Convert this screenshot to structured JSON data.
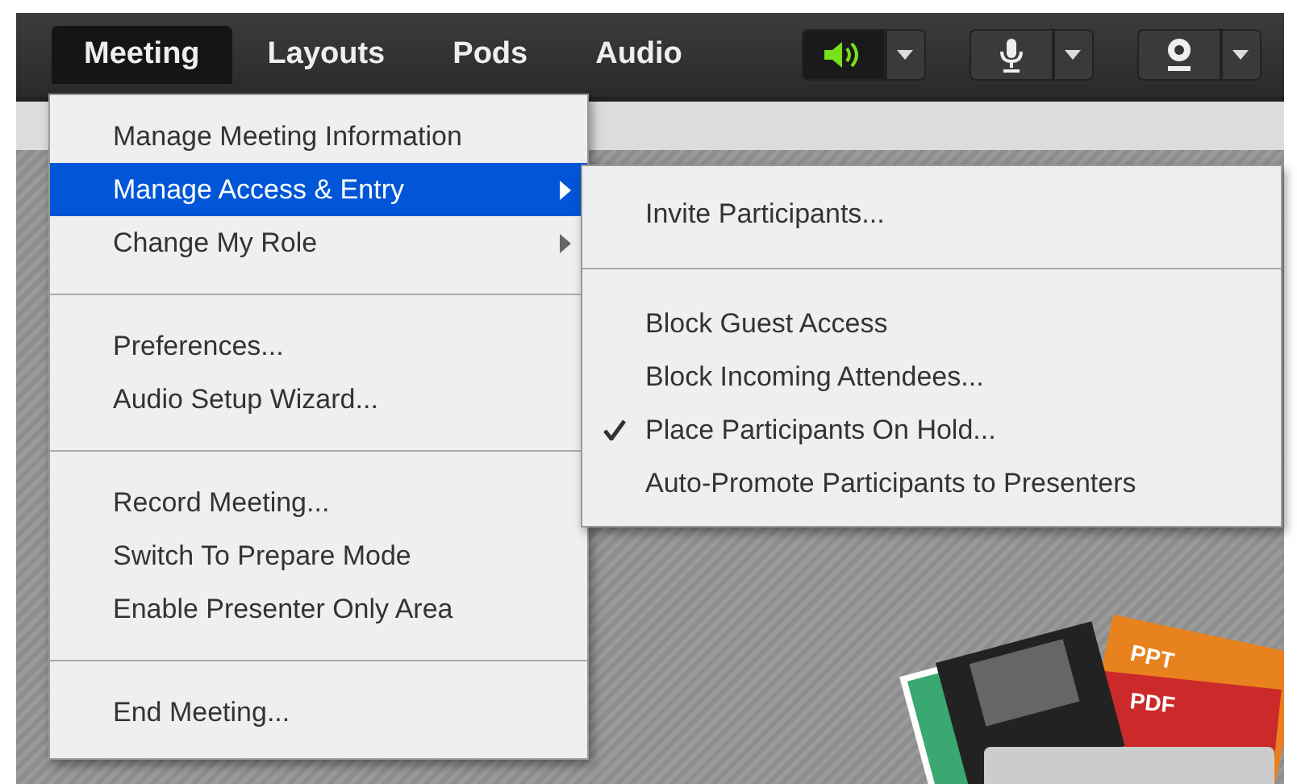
{
  "menubar": {
    "menus": [
      {
        "label": "Meeting",
        "selected": true
      },
      {
        "label": "Layouts",
        "selected": false
      },
      {
        "label": "Pods",
        "selected": false
      },
      {
        "label": "Audio",
        "selected": false
      }
    ]
  },
  "toolbar": {
    "buttons": [
      {
        "kind": "speaker",
        "on": true
      },
      {
        "kind": "microphone",
        "on": false
      },
      {
        "kind": "camera",
        "on": false
      }
    ]
  },
  "meeting_menu": {
    "items": [
      {
        "kind": "item",
        "label": "Manage Meeting Information",
        "submenu": false,
        "selected": false
      },
      {
        "kind": "item",
        "label": "Manage Access & Entry",
        "submenu": true,
        "selected": true
      },
      {
        "kind": "item",
        "label": "Change My Role",
        "submenu": true,
        "selected": false
      },
      {
        "kind": "separator"
      },
      {
        "kind": "item",
        "label": "Preferences...",
        "submenu": false,
        "selected": false
      },
      {
        "kind": "item",
        "label": "Audio Setup Wizard...",
        "submenu": false,
        "selected": false
      },
      {
        "kind": "separator"
      },
      {
        "kind": "item",
        "label": "Record Meeting...",
        "submenu": false,
        "selected": false
      },
      {
        "kind": "item",
        "label": "Switch To Prepare Mode",
        "submenu": false,
        "selected": false
      },
      {
        "kind": "item",
        "label": "Enable Presenter Only Area",
        "submenu": false,
        "selected": false
      },
      {
        "kind": "separator"
      },
      {
        "kind": "item",
        "label": "End Meeting...",
        "submenu": false,
        "selected": false
      }
    ]
  },
  "submenu": {
    "items": [
      {
        "kind": "item",
        "label": "Invite Participants...",
        "checked": false
      },
      {
        "kind": "separator"
      },
      {
        "kind": "item",
        "label": "Block Guest Access",
        "checked": false
      },
      {
        "kind": "item",
        "label": "Block Incoming Attendees...",
        "checked": false
      },
      {
        "kind": "item",
        "label": "Place Participants On Hold...",
        "checked": true
      },
      {
        "kind": "item",
        "label": "Auto-Promote Participants to Presenters",
        "checked": false
      }
    ]
  },
  "artwork": {
    "labels": [
      "PPT",
      "PDF"
    ]
  }
}
